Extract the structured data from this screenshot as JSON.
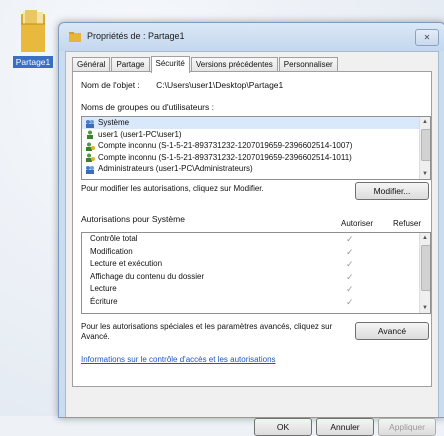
{
  "desktop": {
    "icon_label": "Partage1",
    "icon": "folder-icon"
  },
  "window": {
    "title": "Propriétés de : Partage1",
    "close_glyph": "✕",
    "tabs": [
      {
        "label": "Général"
      },
      {
        "label": "Partage"
      },
      {
        "label": "Sécurité",
        "active": true
      },
      {
        "label": "Versions précédentes"
      },
      {
        "label": "Personnaliser"
      }
    ],
    "object_name_label": "Nom de l'objet :",
    "object_name_value": "C:\\Users\\user1\\Desktop\\Partage1",
    "groups_label": "Noms de groupes ou d'utilisateurs :",
    "groups": [
      {
        "name": "Système",
        "icon": "group-icon"
      },
      {
        "name": "user1 (user1-PC\\user1)",
        "icon": "user-icon"
      },
      {
        "name": "Compte inconnu (S-1-5-21-893731232-1207019659-2396602514-1007)",
        "icon": "unknown-user-icon"
      },
      {
        "name": "Compte inconnu (S-1-5-21-893731232-1207019659-2396602514-1011)",
        "icon": "unknown-user-icon"
      },
      {
        "name": "Administrateurs (user1-PC\\Administrateurs)",
        "icon": "group-icon"
      }
    ],
    "modify_hint": "Pour modifier les autorisations, cliquez sur Modifier.",
    "modify_button": "Modifier...",
    "permissions_label": "Autorisations pour Système",
    "col_allow": "Autoriser",
    "col_deny": "Refuser",
    "permissions": [
      {
        "name": "Contrôle total",
        "allow": true
      },
      {
        "name": "Modification",
        "allow": true
      },
      {
        "name": "Lecture et exécution",
        "allow": true
      },
      {
        "name": "Affichage du contenu du dossier",
        "allow": true
      },
      {
        "name": "Lecture",
        "allow": true
      },
      {
        "name": "Écriture",
        "allow": true
      }
    ],
    "check_glyph": "✓",
    "special_text": "Pour les autorisations spéciales et les paramètres avancés, cliquez sur Avancé.",
    "advanced_button": "Avancé",
    "link_text": "Informations sur le contrôle d'accès et les autorisations",
    "ok_button": "OK",
    "cancel_button": "Annuler",
    "apply_button": "Appliquer"
  }
}
